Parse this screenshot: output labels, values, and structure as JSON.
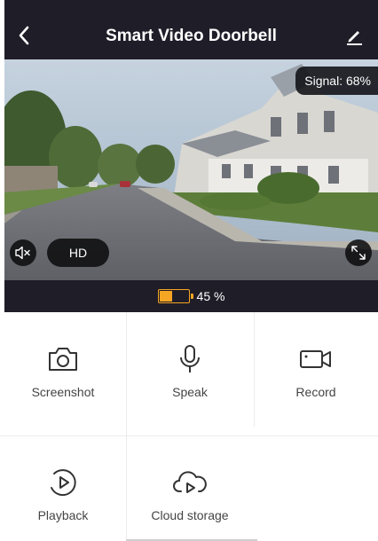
{
  "header": {
    "title": "Smart Video Doorbell",
    "back_icon": "chevron-left-icon",
    "edit_icon": "pencil-icon"
  },
  "video": {
    "signal_label": "Signal: 68%",
    "quality_label": "HD",
    "mute_icon": "speaker-muted-icon",
    "fullscreen_icon": "expand-icon"
  },
  "status": {
    "battery_text": "45 %",
    "battery_level": 0.45,
    "battery_color": "#f5a623"
  },
  "actions": [
    {
      "label": "Screenshot",
      "icon": "camera-icon"
    },
    {
      "label": "Speak",
      "icon": "microphone-icon"
    },
    {
      "label": "Record",
      "icon": "video-camera-icon"
    },
    {
      "label": "Playback",
      "icon": "playback-icon"
    },
    {
      "label": "Cloud storage",
      "icon": "cloud-play-icon"
    }
  ],
  "colors": {
    "bar_background": "#1f1d28",
    "accent": "#f5a623"
  }
}
